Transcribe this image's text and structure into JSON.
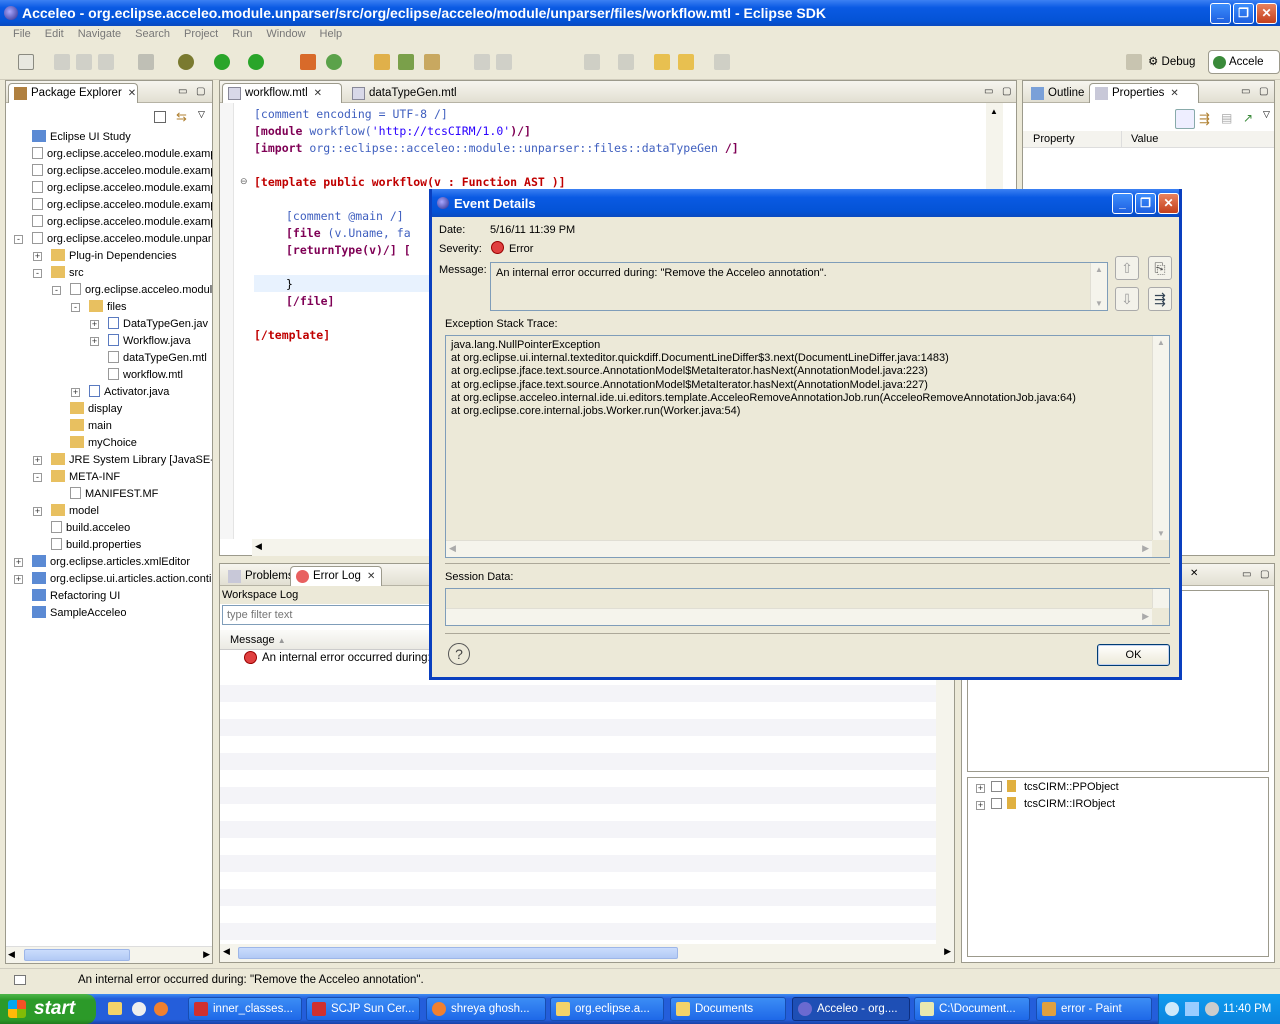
{
  "window": {
    "title": "Acceleo - org.eclipse.acceleo.module.unparser/src/org/eclipse/acceleo/module/unparser/files/workflow.mtl - Eclipse SDK"
  },
  "menu": [
    "File",
    "Edit",
    "Navigate",
    "Search",
    "Project",
    "Run",
    "Window",
    "Help"
  ],
  "perspectives": {
    "debug": "Debug",
    "acceleo": "Accele"
  },
  "package_explorer": {
    "tab": "Package Explorer",
    "items": [
      {
        "label": "Eclipse UI Study",
        "depth": 0,
        "exp": ""
      },
      {
        "label": "org.eclipse.acceleo.module.examp",
        "depth": 0,
        "exp": ""
      },
      {
        "label": "org.eclipse.acceleo.module.examp",
        "depth": 0,
        "exp": ""
      },
      {
        "label": "org.eclipse.acceleo.module.examp",
        "depth": 0,
        "exp": ""
      },
      {
        "label": "org.eclipse.acceleo.module.examp",
        "depth": 0,
        "exp": ""
      },
      {
        "label": "org.eclipse.acceleo.module.examp",
        "depth": 0,
        "exp": ""
      },
      {
        "label": "org.eclipse.acceleo.module.unpar",
        "depth": 0,
        "exp": "-"
      },
      {
        "label": "Plug-in Dependencies",
        "depth": 1,
        "exp": "+"
      },
      {
        "label": "src",
        "depth": 1,
        "exp": "-"
      },
      {
        "label": "org.eclipse.acceleo.modul",
        "depth": 2,
        "exp": "-"
      },
      {
        "label": "files",
        "depth": 3,
        "exp": "-"
      },
      {
        "label": "DataTypeGen.jav",
        "depth": 4,
        "exp": "+"
      },
      {
        "label": "Workflow.java",
        "depth": 4,
        "exp": "+"
      },
      {
        "label": "dataTypeGen.mtl",
        "depth": 4,
        "exp": ""
      },
      {
        "label": "workflow.mtl",
        "depth": 4,
        "exp": ""
      },
      {
        "label": "Activator.java",
        "depth": 3,
        "exp": "+"
      },
      {
        "label": "display",
        "depth": 2,
        "exp": ""
      },
      {
        "label": "main",
        "depth": 2,
        "exp": ""
      },
      {
        "label": "myChoice",
        "depth": 2,
        "exp": ""
      },
      {
        "label": "JRE System Library [JavaSE-1",
        "depth": 1,
        "exp": "+"
      },
      {
        "label": "META-INF",
        "depth": 1,
        "exp": "-"
      },
      {
        "label": "MANIFEST.MF",
        "depth": 2,
        "exp": ""
      },
      {
        "label": "model",
        "depth": 1,
        "exp": "+"
      },
      {
        "label": "build.acceleo",
        "depth": 1,
        "exp": ""
      },
      {
        "label": "build.properties",
        "depth": 1,
        "exp": ""
      },
      {
        "label": "org.eclipse.articles.xmlEditor",
        "depth": 0,
        "exp": "+"
      },
      {
        "label": "org.eclipse.ui.articles.action.conti",
        "depth": 0,
        "exp": "+"
      },
      {
        "label": "Refactoring UI",
        "depth": 0,
        "exp": ""
      },
      {
        "label": "SampleAcceleo",
        "depth": 0,
        "exp": ""
      }
    ]
  },
  "editor": {
    "tabs": [
      "workflow.mtl",
      "dataTypeGen.mtl"
    ],
    "lines": {
      "l1": "[comment encoding = UTF-8 /]",
      "l2a": "[module",
      "l2b": " workflow(",
      "l2c": "'http://tcsCIRM/1.0'",
      "l2d": ")/]",
      "l3a": "[import",
      "l3b": " org::eclipse::acceleo::module::unparser::files::dataTypeGen ",
      "l3c": "/]",
      "l4a": "[template",
      "l4b": " public workflow(v : Function AST )]",
      "l5": "[comment @main /]",
      "l6a": "[file",
      "l6b": " (v.Uname, fa",
      "l7a": "[returnType(v)/]",
      "l7b": " [",
      "l8": "}",
      "l9": "[/file]",
      "l10": "[/template]"
    }
  },
  "outline": {
    "tab": "Outline"
  },
  "properties": {
    "tab": "Properties",
    "col_property": "Property",
    "col_value": "Value"
  },
  "bottom": {
    "tab_problems": "Problems",
    "tab_errorlog": "Error Log",
    "workspace_log": "Workspace Log",
    "filter_placeholder": "type filter text",
    "col_message": "Message",
    "row1": "An internal error occurred during: \""
  },
  "right_tree": [
    "tcsCIRM::PPObject",
    "tcsCIRM::IRObject"
  ],
  "dialog": {
    "title": "Event Details",
    "date_label": "Date:",
    "date": "5/16/11 11:39 PM",
    "severity_label": "Severity:",
    "severity": "Error",
    "message_label": "Message:",
    "message": "An internal error occurred during: \"Remove the Acceleo annotation\".",
    "trace_label": "Exception Stack Trace:",
    "trace": [
      "java.lang.NullPointerException",
      "at org.eclipse.ui.internal.texteditor.quickdiff.DocumentLineDiffer$3.next(DocumentLineDiffer.java:1483)",
      "at org.eclipse.jface.text.source.AnnotationModel$MetaIterator.hasNext(AnnotationModel.java:223)",
      "at org.eclipse.jface.text.source.AnnotationModel$MetaIterator.hasNext(AnnotationModel.java:227)",
      "at org.eclipse.acceleo.internal.ide.ui.editors.template.AcceleoRemoveAnnotationJob.run(AcceleoRemoveAnnotationJob.java:64)",
      "at org.eclipse.core.internal.jobs.Worker.run(Worker.java:54)"
    ],
    "session_label": "Session Data:",
    "ok": "OK"
  },
  "status": {
    "text": "An internal error occurred during: \"Remove the Acceleo annotation\"."
  },
  "taskbar": {
    "start": "start",
    "items": [
      "inner_classes...",
      "SCJP Sun Cer...",
      "shreya ghosh...",
      "org.eclipse.a...",
      "Documents",
      "Acceleo - org....",
      "C:\\Document...",
      "error - Paint"
    ],
    "clock": "11:40 PM"
  }
}
